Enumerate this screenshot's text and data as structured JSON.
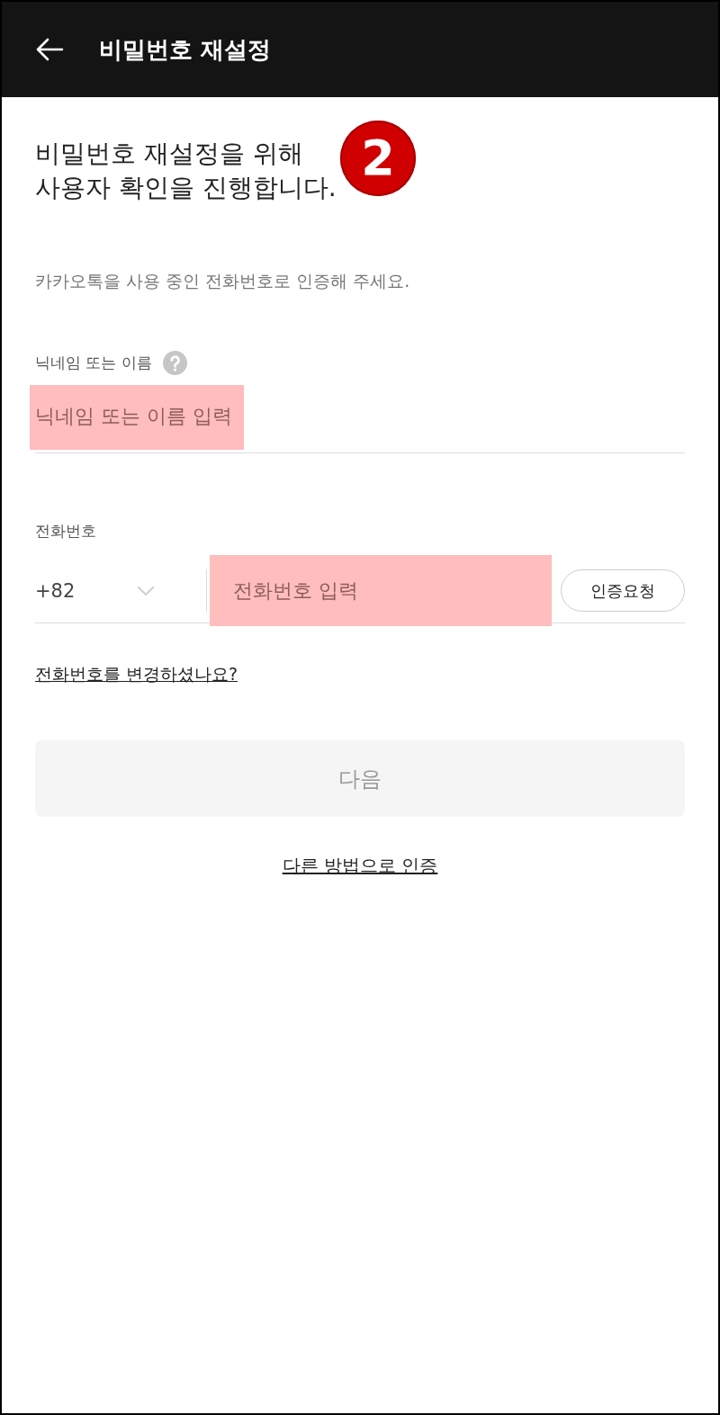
{
  "header": {
    "title": "비밀번호 재설정"
  },
  "step_badge": "2",
  "heading": [
    "비밀번호 재설정을 위해",
    "사용자 확인을 진행합니다."
  ],
  "subtitle": "카카오톡을 사용 중인 전화번호로 인증해 주세요.",
  "name_field": {
    "label": "닉네임 또는 이름",
    "placeholder": "닉네임 또는 이름 입력",
    "highlighted": true
  },
  "phone_field": {
    "label": "전화번호",
    "country_code": "+82",
    "placeholder": "전화번호 입력",
    "highlighted": true,
    "request_button": "인증요청"
  },
  "change_phone_link": "전화번호를 변경하셨나요?",
  "next_button": {
    "label": "다음",
    "disabled": true
  },
  "other_method_link": "다른 방법으로 인증"
}
